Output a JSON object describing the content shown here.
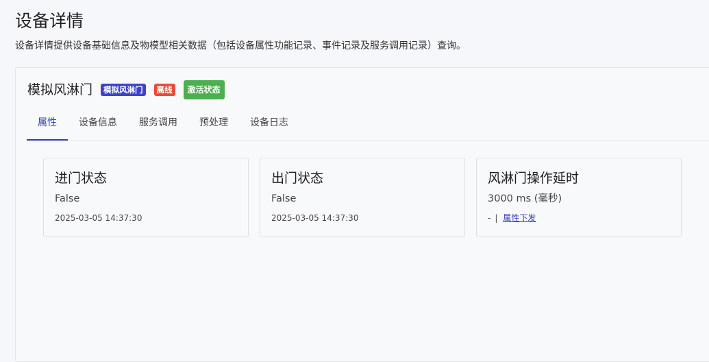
{
  "page": {
    "title": "设备详情",
    "description": "设备详情提供设备基础信息及物模型相关数据（包括设备属性功能记录、事件记录及服务调用记录）查询。"
  },
  "device": {
    "name": "模拟风淋门",
    "model_badge": "模拟风淋门",
    "status_badge": "离线",
    "activate_label": "激活状态",
    "colors": {
      "model_badge": "#3f43c8",
      "offline_badge": "#e74b3c",
      "activate_button": "#4caf50",
      "tab_active": "#3b3fb6"
    }
  },
  "tabs": [
    {
      "label": "属性",
      "active": true
    },
    {
      "label": "设备信息",
      "active": false
    },
    {
      "label": "服务调用",
      "active": false
    },
    {
      "label": "预处理",
      "active": false
    },
    {
      "label": "设备日志",
      "active": false
    }
  ],
  "properties": [
    {
      "title": "进门状态",
      "value": "False",
      "time": "2025-03-05 14:37:30"
    },
    {
      "title": "出门状态",
      "value": "False",
      "time": "2025-03-05 14:37:30"
    },
    {
      "title": "风淋门操作延时",
      "value": "3000 ms (毫秒)",
      "action_prefix": "-",
      "action_sep": "|",
      "action_label": "属性下发"
    }
  ]
}
